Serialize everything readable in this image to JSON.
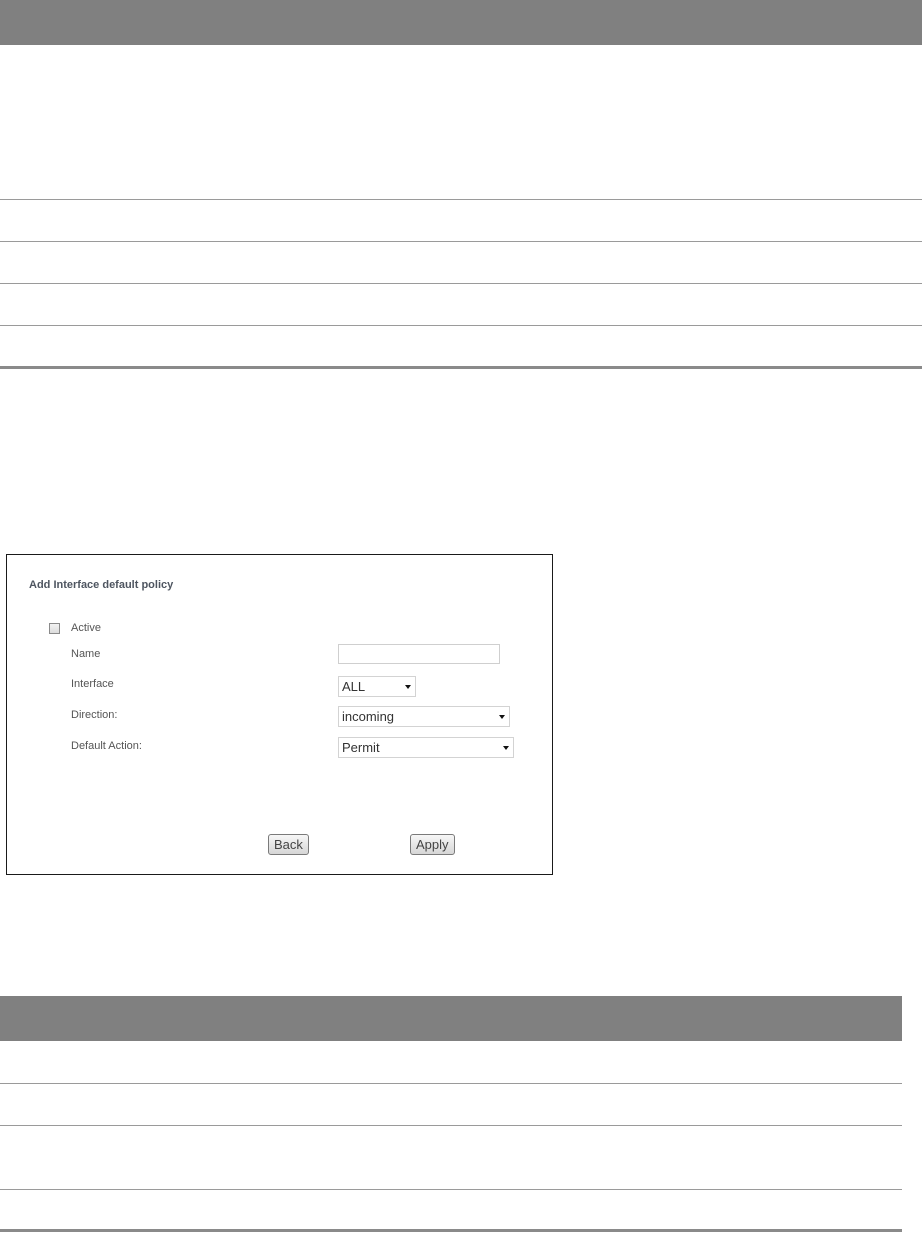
{
  "form": {
    "title": "Add Interface default policy",
    "active_label": "Active",
    "name_label": "Name",
    "name_value": "",
    "interface_label": "Interface",
    "interface_value": "ALL",
    "direction_label": "Direction:",
    "direction_value": "incoming",
    "default_action_label": "Default Action:",
    "default_action_value": "Permit",
    "back_label": "Back",
    "apply_label": "Apply"
  },
  "colors": {
    "table_header": "#808080",
    "panel_border": "#1a1a1a",
    "label_text": "#555555"
  }
}
